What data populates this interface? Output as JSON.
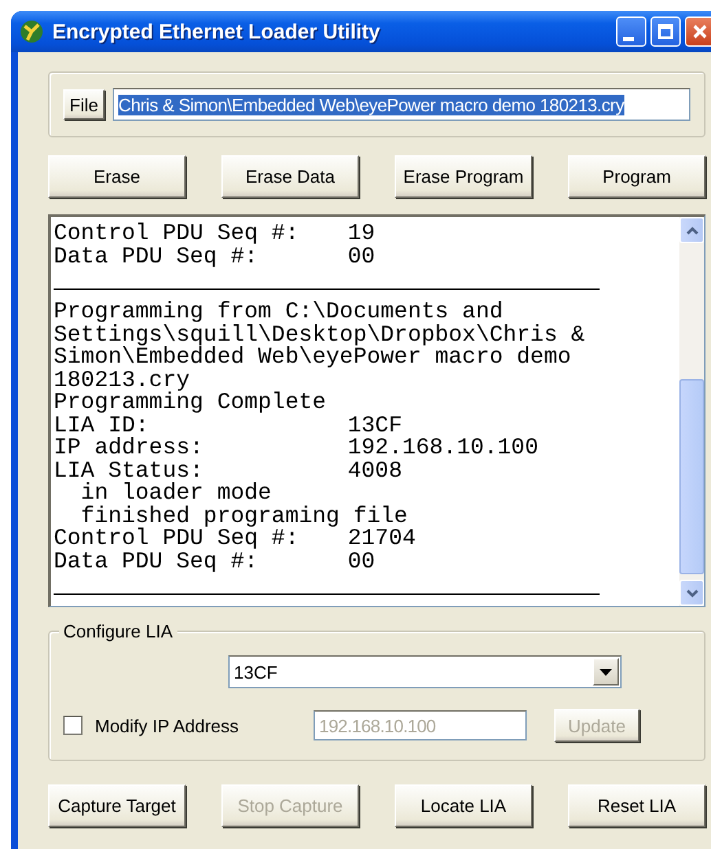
{
  "window": {
    "title": "Encrypted Ethernet Loader Utility"
  },
  "file": {
    "button": "File",
    "path": "Chris & Simon\\Embedded Web\\eyePower macro demo 180213.cry",
    "highlighted": true
  },
  "actions": [
    {
      "label": "Erase",
      "disabled": false
    },
    {
      "label": "Erase Data",
      "disabled": false
    },
    {
      "label": "Erase Program",
      "disabled": false
    },
    {
      "label": "Program",
      "disabled": false
    }
  ],
  "log": [
    {
      "kind": "pair",
      "label": "Control PDU Seq #:",
      "value": "19"
    },
    {
      "kind": "pair",
      "label": "Data PDU Seq #:",
      "value": "00"
    },
    {
      "kind": "rule"
    },
    {
      "kind": "text",
      "text": "Programming from C:\\Documents and"
    },
    {
      "kind": "text",
      "text": "Settings\\squill\\Desktop\\Dropbox\\Chris &"
    },
    {
      "kind": "text",
      "text": "Simon\\Embedded Web\\eyePower macro demo"
    },
    {
      "kind": "text",
      "text": "180213.cry"
    },
    {
      "kind": "text",
      "text": "Programming Complete"
    },
    {
      "kind": "pair",
      "label": "LIA ID:",
      "value": "13CF"
    },
    {
      "kind": "pair",
      "label": "IP address:",
      "value": "192.168.10.100"
    },
    {
      "kind": "pair",
      "label": "LIA Status:",
      "value": "4008"
    },
    {
      "kind": "indent",
      "text": "in loader mode"
    },
    {
      "kind": "indent",
      "text": "finished programing file"
    },
    {
      "kind": "pair",
      "label": "Control PDU Seq #:",
      "value": "21704"
    },
    {
      "kind": "pair",
      "label": "Data PDU Seq #:",
      "value": "00"
    },
    {
      "kind": "rule"
    }
  ],
  "configure": {
    "title": "Configure LIA",
    "lia": "13CF",
    "modify_ip": {
      "label": "Modify IP Address",
      "checked": false
    },
    "ip": {
      "value": "192.168.10.100",
      "disabled": true
    },
    "update": {
      "label": "Update",
      "disabled": true
    }
  },
  "bottom_buttons": [
    {
      "label": "Capture Target",
      "disabled": false
    },
    {
      "label": "Stop Capture",
      "disabled": true
    },
    {
      "label": "Locate LIA",
      "disabled": false
    },
    {
      "label": "Reset LIA",
      "disabled": false
    }
  ]
}
